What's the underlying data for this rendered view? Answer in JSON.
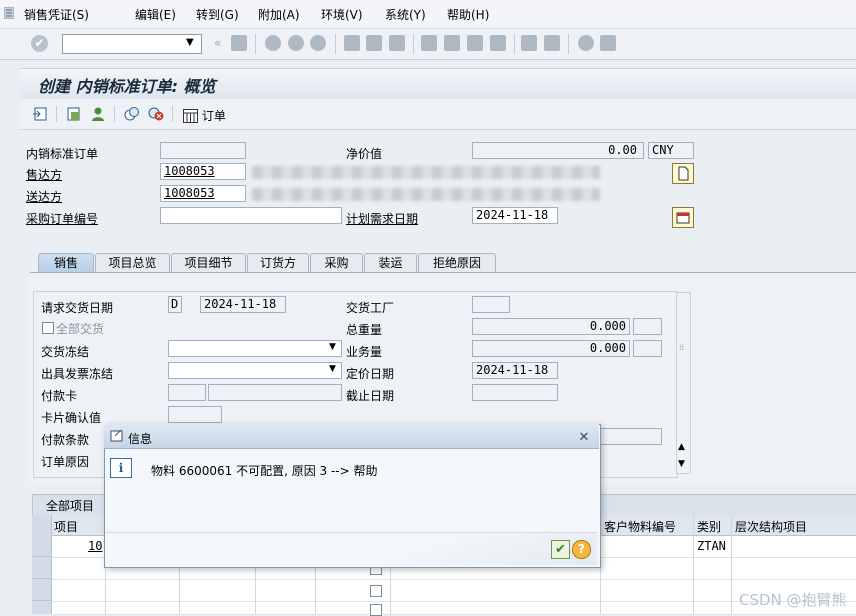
{
  "menu": [
    "销售凭证(S)",
    "编辑(E)",
    "转到(G)",
    "附加(A)",
    "环境(V)",
    "系统(Y)",
    "帮助(H)"
  ],
  "title": "创建 内销标准订单: 概览",
  "app_toolbar": {
    "order_label": "订单"
  },
  "header": {
    "order_type_label": "内销标准订单",
    "net_value_label": "净价值",
    "net_value": "0.00",
    "currency": "CNY",
    "sold_to_label": "售达方",
    "sold_to_value": "1008053",
    "ship_to_label": "送达方",
    "ship_to_value": "1008053",
    "po_number_label": "采购订单编号",
    "req_delivery_date_label": "计划需求日期",
    "req_delivery_date": "2024-11-18"
  },
  "tabs": [
    "销售",
    "项目总览",
    "项目细节",
    "订货方",
    "采购",
    "装运",
    "拒绝原因"
  ],
  "sales_tab": {
    "req_deliv_date_label": "请求交货日期",
    "req_deliv_date_type": "D",
    "req_deliv_date": "2024-11-18",
    "complete_delivery_label": "全部交货",
    "delivery_block_label": "交货冻结",
    "billing_block_label": "出具发票冻结",
    "payment_card_label": "付款卡",
    "card_verification_label": "卡片确认值",
    "payment_terms_label": "付款条款",
    "order_reason_label": "订单原因",
    "plant_label": "交货工厂",
    "total_weight_label": "总重量",
    "total_weight": "0.000",
    "volume_label": "业务量",
    "volume": "0.000",
    "pricing_date_label": "定价日期",
    "pricing_date": "2024-11-18",
    "expiry_date_label": "截止日期"
  },
  "items_grid": {
    "title": "全部项目",
    "col_item": "项目",
    "col_customer_material": "客户物料编号",
    "col_category": "类别",
    "col_hierarchy": "层次结构项目",
    "row1_item": "10",
    "row1_category": "ZTAN"
  },
  "dialog": {
    "title": "信息",
    "message": "物料 6600061 不可配置, 原因 3 --> 帮助"
  },
  "watermark": "CSDN @抱臂熊"
}
